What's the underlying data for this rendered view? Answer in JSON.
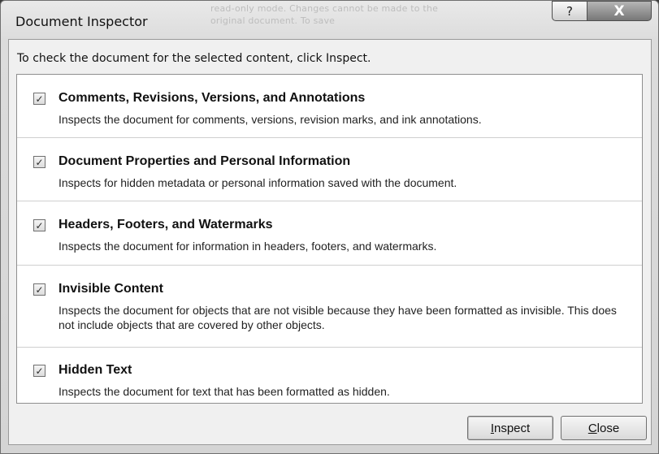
{
  "window": {
    "title": "Document Inspector",
    "background_text": "read-only mode. Changes cannot be made to the original document. To save",
    "help_glyph": "?",
    "close_glyph": "X"
  },
  "instruction": "To check the document for the selected content, click Inspect.",
  "items": [
    {
      "checked": true,
      "title": "Comments, Revisions, Versions, and Annotations",
      "description": "Inspects the document for comments, versions, revision marks, and ink annotations."
    },
    {
      "checked": true,
      "title": "Document Properties and Personal Information",
      "description": "Inspects for hidden metadata or personal information saved with the document."
    },
    {
      "checked": true,
      "title": "Headers, Footers, and Watermarks",
      "description": "Inspects the document for information in headers, footers, and watermarks."
    },
    {
      "checked": true,
      "title": "Invisible Content",
      "description": "Inspects the document for objects that are not visible because they have been formatted as invisible. This does not include objects that are covered by other objects."
    },
    {
      "checked": true,
      "title": "Hidden Text",
      "description": "Inspects the document for text that has been formatted as hidden."
    }
  ],
  "buttons": {
    "inspect": {
      "mnemonic": "I",
      "rest": "nspect"
    },
    "close": {
      "mnemonic": "C",
      "rest": "lose"
    }
  },
  "checkmark_glyph": "✓"
}
